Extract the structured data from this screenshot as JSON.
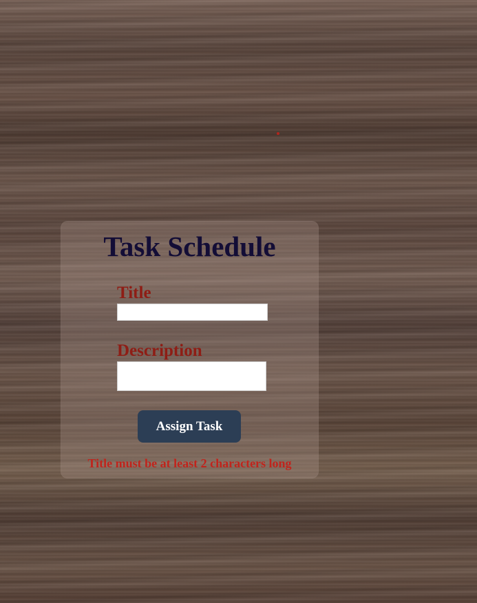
{
  "form": {
    "title": "Task Schedule",
    "title_label": "Title",
    "title_value": "",
    "description_label": "Description",
    "description_value": "",
    "submit_label": "Assign Task",
    "error_message": "Title must be at least 2 characters long"
  },
  "colors": {
    "heading": "#130d36",
    "label": "#8e1d15",
    "button": "#2c3e55",
    "error": "#c0241c"
  }
}
